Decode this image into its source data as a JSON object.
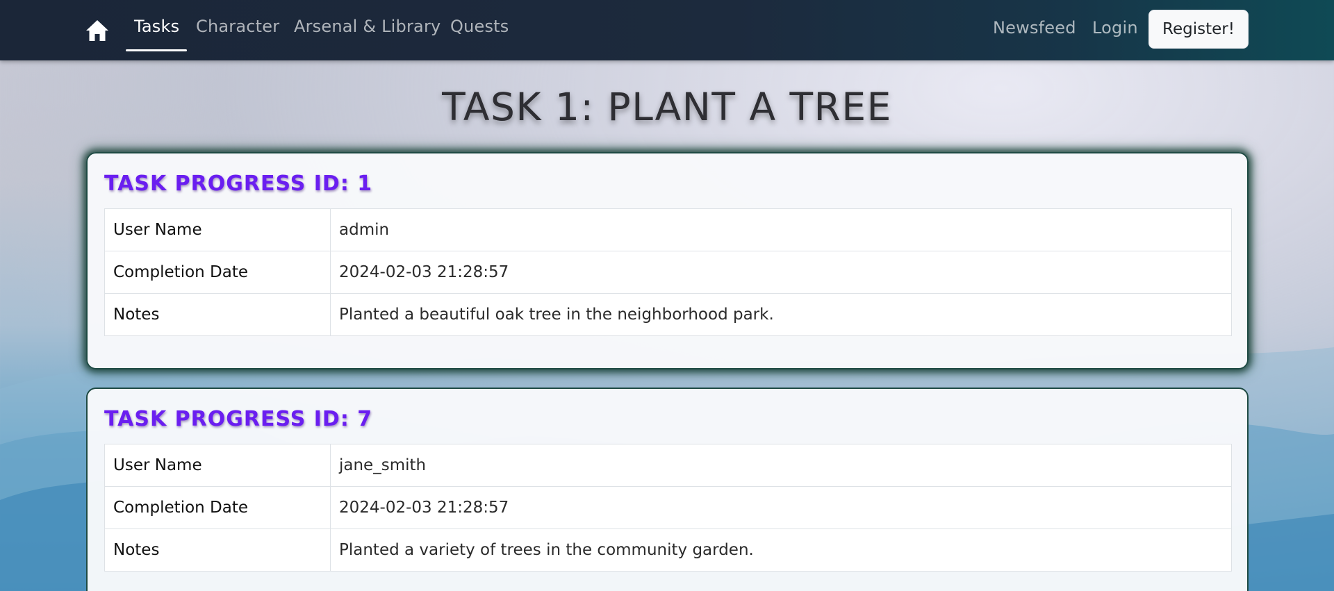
{
  "nav": {
    "home_icon": "home-icon",
    "links": [
      {
        "label": "Tasks",
        "active": true
      },
      {
        "label": "Character",
        "active": false
      },
      {
        "label": "Arsenal & Library",
        "active": false
      },
      {
        "label": "Quests",
        "active": false
      }
    ],
    "right_links": [
      {
        "label": "Newsfeed"
      },
      {
        "label": "Login"
      }
    ],
    "register_label": "Register!"
  },
  "page": {
    "title": "TASK 1: PLANT A TREE"
  },
  "cards": [
    {
      "title": "Task Progress ID: 1",
      "rows": [
        {
          "key": "User Name",
          "value": "admin"
        },
        {
          "key": "Completion Date",
          "value": "2024-02-03 21:28:57"
        },
        {
          "key": "Notes",
          "value": "Planted a beautiful oak tree in the neighborhood park."
        }
      ]
    },
    {
      "title": "Task Progress ID: 7",
      "rows": [
        {
          "key": "User Name",
          "value": "jane_smith"
        },
        {
          "key": "Completion Date",
          "value": "2024-02-03 21:28:57"
        },
        {
          "key": "Notes",
          "value": "Planted a variety of trees in the community garden."
        }
      ]
    }
  ],
  "colors": {
    "navbar": "#1b2638",
    "card_title": "#6a1ef0",
    "card_border": "#1e4a43"
  }
}
